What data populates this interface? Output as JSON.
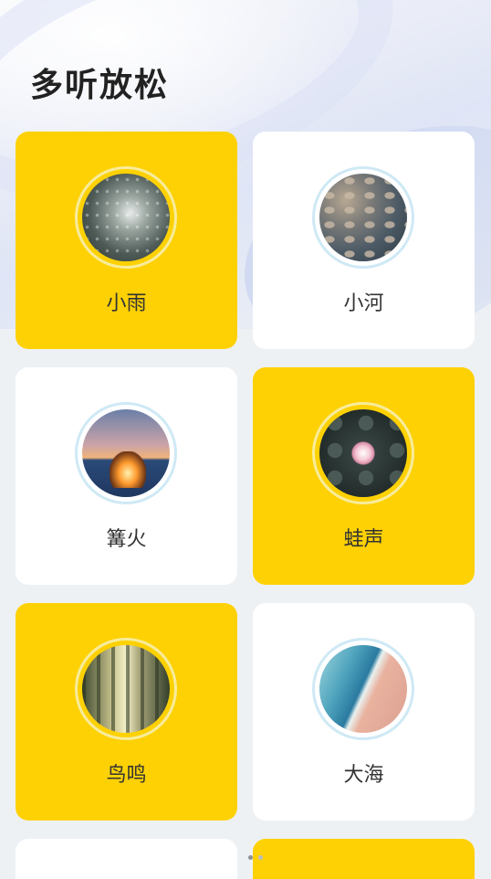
{
  "page": {
    "title": "多听放松"
  },
  "cards": [
    {
      "label": "小雨",
      "icon": "rain-thumbnail",
      "style": "yellow"
    },
    {
      "label": "小河",
      "icon": "river-thumbnail",
      "style": "white"
    },
    {
      "label": "篝火",
      "icon": "campfire-thumbnail",
      "style": "white"
    },
    {
      "label": "蛙声",
      "icon": "frog-pond-thumbnail",
      "style": "yellow"
    },
    {
      "label": "鸟鸣",
      "icon": "forest-birds-thumbnail",
      "style": "yellow"
    },
    {
      "label": "大海",
      "icon": "sea-thumbnail",
      "style": "white"
    },
    {
      "label": "",
      "icon": "",
      "style": "white"
    },
    {
      "label": "",
      "icon": "",
      "style": "yellow"
    }
  ],
  "pager": {
    "count": 2,
    "active": 0
  },
  "colors": {
    "accent": "#fed105",
    "card": "#ffffff",
    "background": "#eef1f4",
    "ring": "#cfe9f5"
  }
}
